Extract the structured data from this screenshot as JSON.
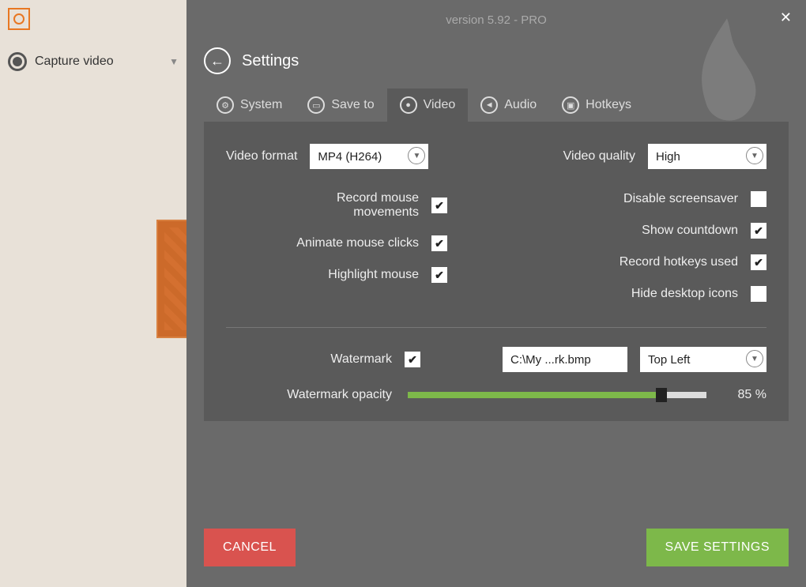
{
  "version": "version 5.92 - PRO",
  "sidebar": {
    "capture_label": "Capture video"
  },
  "settings": {
    "title": "Settings",
    "tabs": {
      "system": "System",
      "saveto": "Save to",
      "video": "Video",
      "audio": "Audio",
      "hotkeys": "Hotkeys"
    },
    "video_format_label": "Video format",
    "video_format_value": "MP4 (H264)",
    "video_quality_label": "Video quality",
    "video_quality_value": "High",
    "record_mouse": "Record mouse movements",
    "animate_clicks": "Animate mouse clicks",
    "highlight_mouse": "Highlight mouse",
    "disable_screensaver": "Disable screensaver",
    "show_countdown": "Show countdown",
    "record_hotkeys": "Record hotkeys used",
    "hide_icons": "Hide desktop icons",
    "watermark_label": "Watermark",
    "watermark_path": "C:\\My ...rk.bmp",
    "watermark_pos": "Top Left",
    "opacity_label": "Watermark opacity",
    "opacity_value": "85 %",
    "opacity_pct": 85
  },
  "buttons": {
    "cancel": "CANCEL",
    "save": "SAVE SETTINGS"
  },
  "checks": {
    "record_mouse": true,
    "animate_clicks": true,
    "highlight_mouse": true,
    "disable_screensaver": false,
    "show_countdown": true,
    "record_hotkeys": true,
    "hide_icons": false,
    "watermark": true
  }
}
